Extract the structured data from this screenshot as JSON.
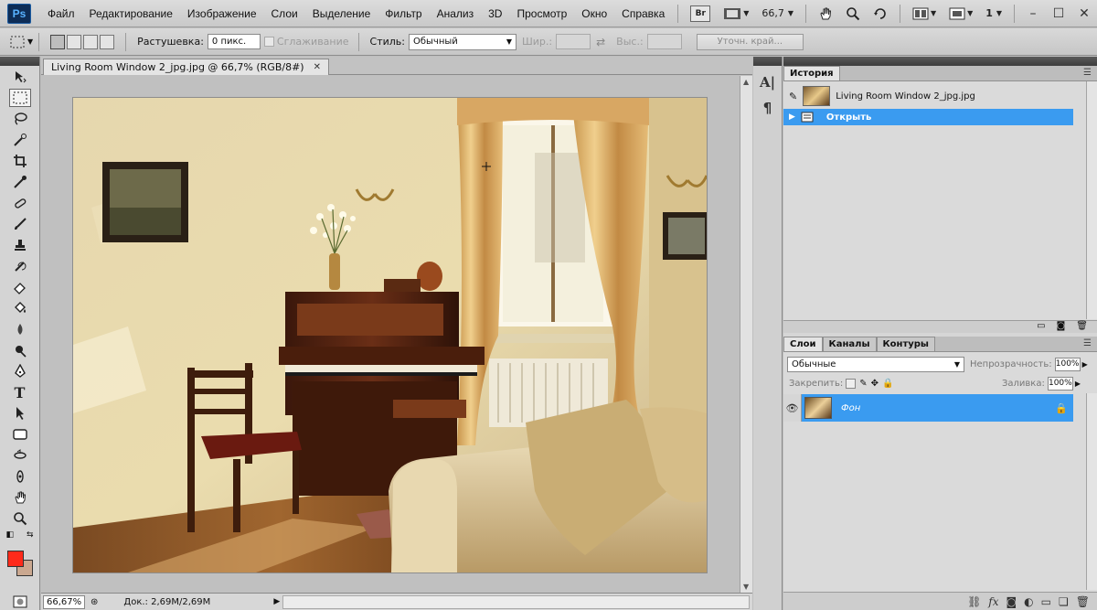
{
  "app": {
    "logo": "Ps"
  },
  "menu": {
    "items": [
      "Файл",
      "Редактирование",
      "Изображение",
      "Слои",
      "Выделение",
      "Фильтр",
      "Анализ",
      "3D",
      "Просмотр",
      "Окно",
      "Справка"
    ],
    "bridge_label": "Br",
    "zoom_value": "66,7",
    "workspace_num": "1"
  },
  "options": {
    "feather_label": "Растушевка:",
    "feather_value": "0 пикс.",
    "antialias_label": "Сглаживание",
    "style_label": "Стиль:",
    "style_value": "Обычный",
    "width_label": "Шир.:",
    "height_label": "Выс.:",
    "refine_edge": "Уточн. край..."
  },
  "document": {
    "tab_title": "Living Room Window 2_jpg.jpg @ 66,7% (RGB/8#)",
    "zoom": "66,67%",
    "doc_size": "Док.: 2,69M/2,69M"
  },
  "history": {
    "tab": "История",
    "snapshot_name": "Living Room Window 2_jpg.jpg",
    "steps": [
      "Открыть"
    ]
  },
  "layers": {
    "tabs": [
      "Слои",
      "Каналы",
      "Контуры"
    ],
    "blend_mode": "Обычные",
    "opacity_label": "Непрозрачность:",
    "opacity_value": "100%",
    "lock_label": "Закрепить:",
    "fill_label": "Заливка:",
    "fill_value": "100%",
    "layer_name": "Фон"
  },
  "icons": {
    "tools": [
      "move-icon",
      "marquee-icon",
      "lasso-icon",
      "quick-select-icon",
      "crop-icon",
      "eyedropper-icon",
      "healing-icon",
      "brush-icon",
      "clone-stamp-icon",
      "history-brush-icon",
      "eraser-icon",
      "paint-bucket-icon",
      "blur-icon",
      "dodge-icon",
      "pen-icon",
      "type-icon",
      "path-select-icon",
      "shape-icon",
      "3d-rotate-icon",
      "3d-orbit-icon",
      "hand-icon",
      "zoom-icon"
    ]
  },
  "colors": {
    "foreground": "#ff2a1a",
    "background": "#caa890",
    "selection_blue": "#3a9bf0"
  }
}
